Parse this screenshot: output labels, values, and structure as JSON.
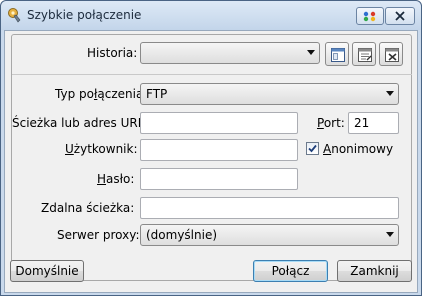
{
  "window": {
    "title": "Szybkie połączenie",
    "icons": {
      "app": "quick-connect-icon",
      "help": "help-icon",
      "close": "close-icon"
    }
  },
  "historia": {
    "label": "Historia:",
    "value": "",
    "icons": [
      "connection-icon",
      "edit-connection-icon",
      "delete-connection-icon"
    ]
  },
  "typ": {
    "label_pre": "Typ po",
    "label_u": "ł",
    "label_post": "ączenia:",
    "value": "FTP"
  },
  "sciezka": {
    "label": "Ścieżka lub adres URL:",
    "value": ""
  },
  "port": {
    "label_u": "P",
    "label_post": "ort:",
    "value": "21"
  },
  "uzytkownik": {
    "label_u": "U",
    "label_post": "żytkownik:",
    "value": ""
  },
  "anonimowy": {
    "label_u": "A",
    "label_post": "nonimowy",
    "checked": true
  },
  "haslo": {
    "label_u": "H",
    "label_post": "asło:",
    "value": ""
  },
  "zdalna": {
    "label": "Zdalna ścieżka:",
    "value": ""
  },
  "proxy": {
    "label": "Serwer proxy:",
    "value": "(domyślnie)"
  },
  "buttons": {
    "defaults": "Domyślnie",
    "connect": "Połącz",
    "close": "Zamknij"
  },
  "colors": {
    "accent": "#3c7fb1",
    "title_bar": "#c3d5ea"
  }
}
